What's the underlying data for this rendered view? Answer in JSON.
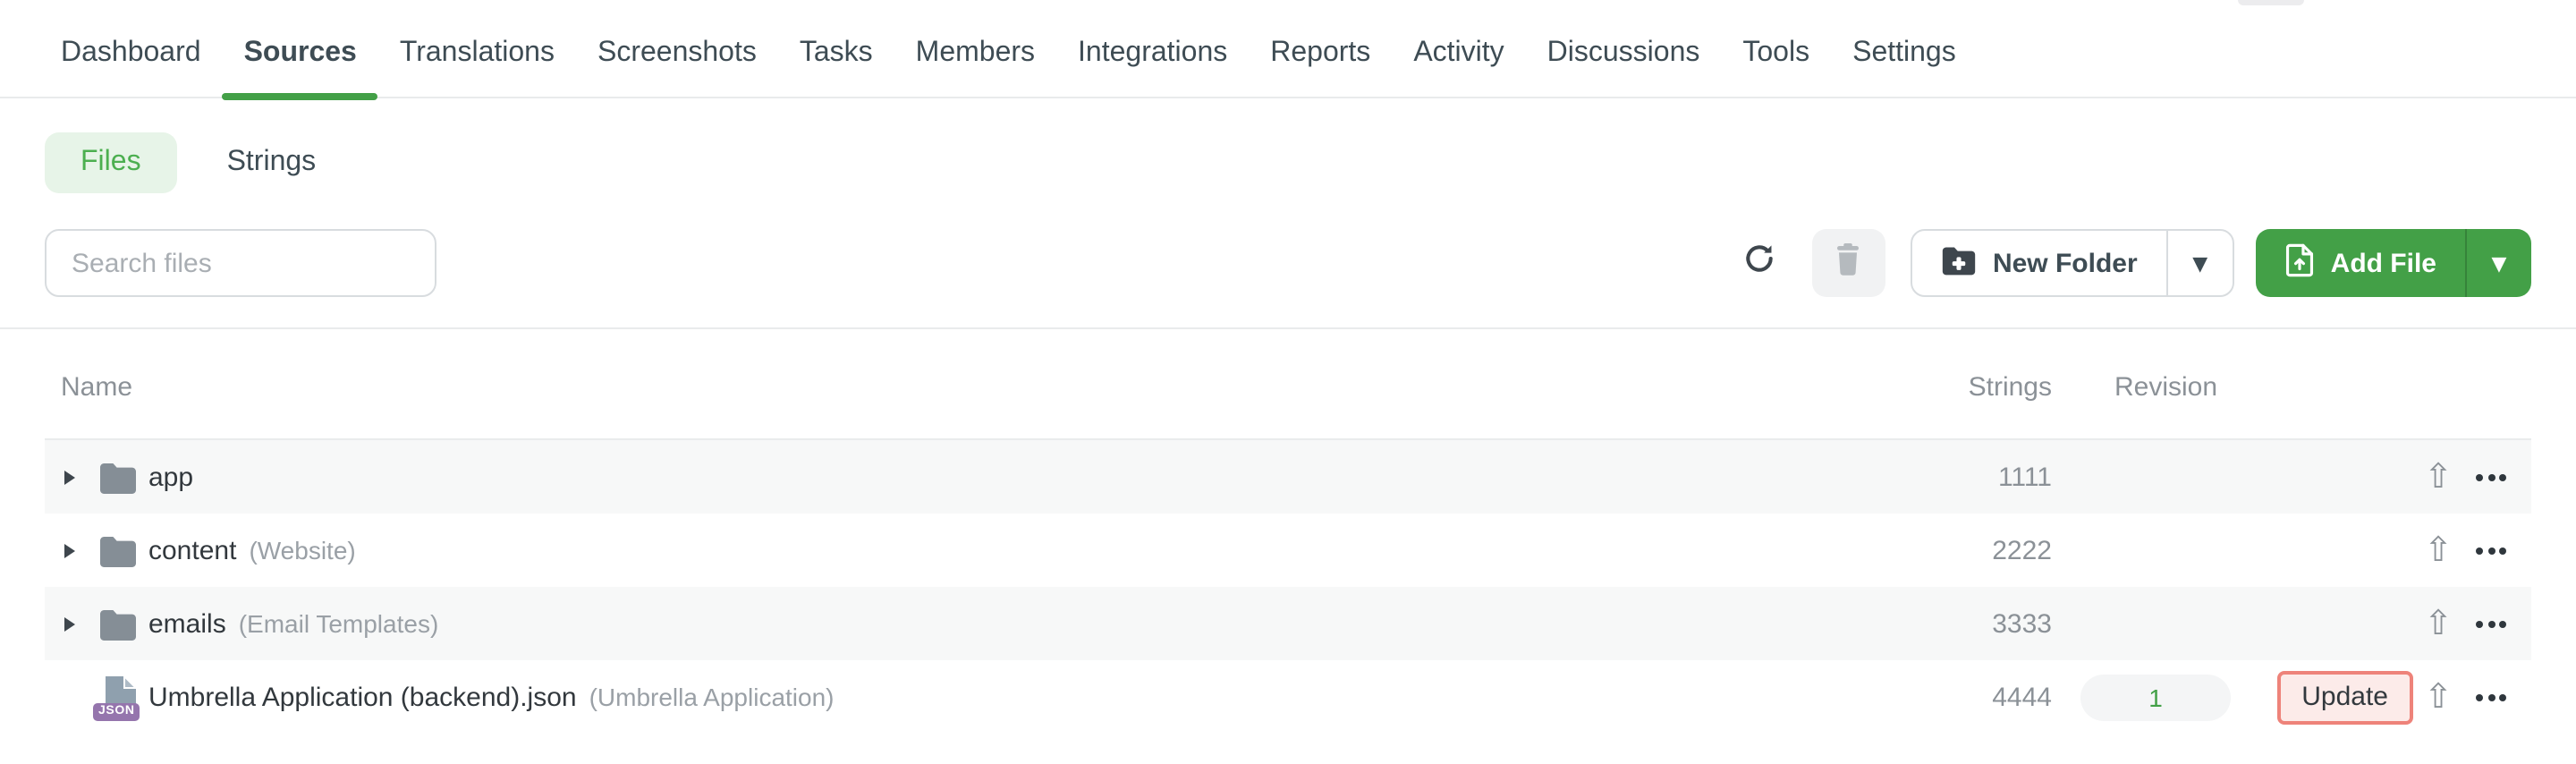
{
  "nav": {
    "items": [
      {
        "label": "Dashboard",
        "active": false
      },
      {
        "label": "Sources",
        "active": true
      },
      {
        "label": "Translations",
        "active": false
      },
      {
        "label": "Screenshots",
        "active": false
      },
      {
        "label": "Tasks",
        "active": false
      },
      {
        "label": "Members",
        "active": false
      },
      {
        "label": "Integrations",
        "active": false
      },
      {
        "label": "Reports",
        "active": false
      },
      {
        "label": "Activity",
        "active": false
      },
      {
        "label": "Discussions",
        "active": false
      },
      {
        "label": "Tools",
        "active": false
      },
      {
        "label": "Settings",
        "active": false
      }
    ]
  },
  "view_toggle": {
    "files_label": "Files",
    "strings_label": "Strings",
    "selected": "Files"
  },
  "toolbar": {
    "search_placeholder": "Search files",
    "search_value": "",
    "refresh_icon": "refresh-icon",
    "delete_icon": "trash-icon",
    "new_folder_label": "New Folder",
    "add_file_label": "Add File"
  },
  "table": {
    "headers": {
      "name": "Name",
      "strings": "Strings",
      "revision": "Revision"
    },
    "rows": [
      {
        "type": "folder",
        "name": "app",
        "annotation": "",
        "strings": "1111",
        "revision": ""
      },
      {
        "type": "folder",
        "name": "content",
        "annotation": "(Website)",
        "strings": "2222",
        "revision": ""
      },
      {
        "type": "folder",
        "name": "emails",
        "annotation": "(Email Templates)",
        "strings": "3333",
        "revision": ""
      },
      {
        "type": "file",
        "file_badge": "JSON",
        "name": "Umbrella Application (backend).json",
        "annotation": "(Umbrella Application)",
        "strings": "4444",
        "revision": "1",
        "update_label": "Update"
      }
    ]
  },
  "colors": {
    "accent_green": "#43a047",
    "files_pill_bg": "#e7f4e8",
    "files_pill_text": "#4caf50",
    "update_border": "#ee837a",
    "update_bg": "#fcebe9",
    "json_badge_bg": "#9575ad",
    "row_zebra_bg": "#f7f8f8",
    "folder_icon": "#858e96"
  }
}
